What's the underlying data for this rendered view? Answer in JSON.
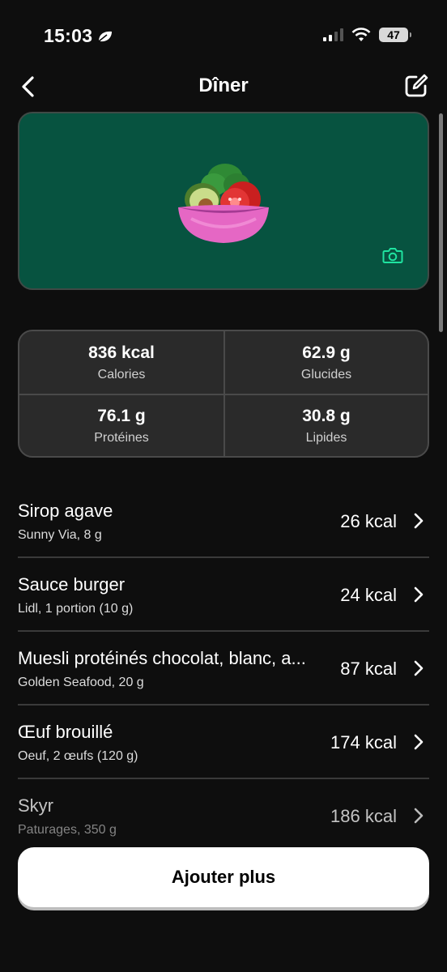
{
  "status": {
    "time": "15:03",
    "battery": "47"
  },
  "header": {
    "title": "Dîner"
  },
  "nutrition": {
    "calories": {
      "value": "836 kcal",
      "label": "Calories"
    },
    "carbs": {
      "value": "62.9 g",
      "label": "Glucides"
    },
    "protein": {
      "value": "76.1 g",
      "label": "Protéines"
    },
    "fat": {
      "value": "30.8 g",
      "label": "Lipides"
    }
  },
  "foods": [
    {
      "name": "Sirop agave",
      "detail": "Sunny Via, 8 g",
      "kcal": "26 kcal"
    },
    {
      "name": "Sauce burger",
      "detail": "Lidl, 1 portion (10 g)",
      "kcal": "24 kcal"
    },
    {
      "name": "Muesli protéinés chocolat, blanc, a...",
      "detail": "Golden Seafood, 20 g",
      "kcal": "87 kcal"
    },
    {
      "name": "Œuf brouillé",
      "detail": "Oeuf, 2 œufs (120 g)",
      "kcal": "174 kcal"
    },
    {
      "name": "Skyr",
      "detail": "Paturages, 350 g",
      "kcal": "186 kcal"
    }
  ],
  "actions": {
    "add_more": "Ajouter plus"
  },
  "colors": {
    "background": "#0e0e0e",
    "photo_card": "#075340",
    "camera_accent": "#1fe3a0",
    "card_bg": "#2a2a2a"
  },
  "icons": {
    "back": "chevron-left-icon",
    "edit": "edit-icon",
    "meal_image": "salad-icon",
    "camera": "camera-icon",
    "row": "chevron-right-icon"
  }
}
